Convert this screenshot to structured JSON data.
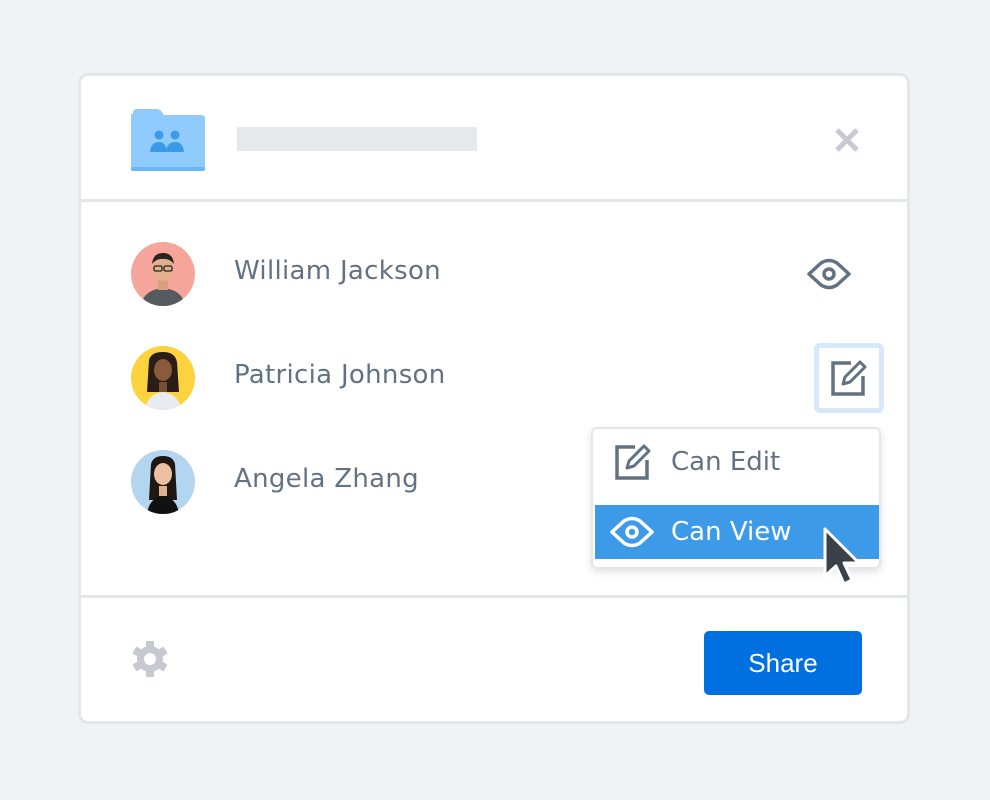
{
  "dialog": {
    "folder_icon": "shared-folder-icon",
    "close_icon": "close-icon"
  },
  "members": [
    {
      "name": "William Jackson",
      "avatar_bg": "#f6a59b",
      "permission_icon": "eye-icon",
      "permission": "Can View"
    },
    {
      "name": "Patricia Johnson",
      "avatar_bg": "#fcd33f",
      "permission_icon": "edit-icon",
      "permission": "Can Edit"
    },
    {
      "name": "Angela Zhang",
      "avatar_bg": "#b4d5ef",
      "permission_icon": "",
      "permission": ""
    }
  ],
  "permission_menu": {
    "items": [
      {
        "label": "Can Edit",
        "icon": "edit-icon",
        "selected": false
      },
      {
        "label": "Can View",
        "icon": "eye-icon",
        "selected": true
      }
    ]
  },
  "footer": {
    "settings_icon": "gear-icon",
    "share_label": "Share"
  },
  "colors": {
    "accent": "#0070e0",
    "menu_highlight": "#3d9ae8",
    "text": "#637282",
    "icon": "#637282",
    "folder": "#8fcbfd"
  }
}
